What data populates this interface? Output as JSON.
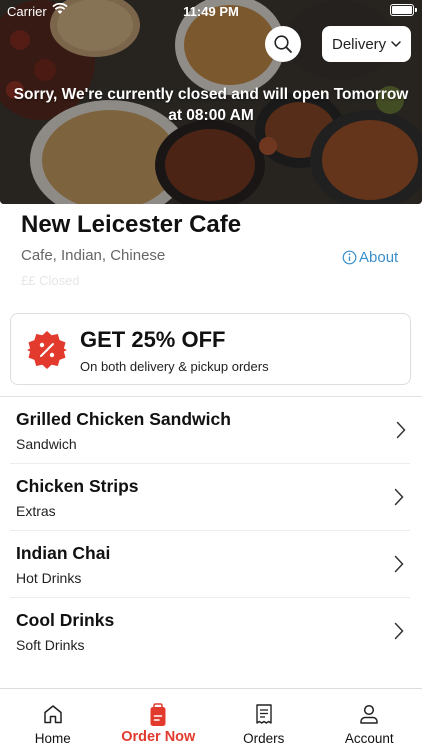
{
  "status_bar": {
    "carrier": "Carrier",
    "time": "11:49 PM"
  },
  "header": {
    "order_mode": "Delivery",
    "closed_message": "Sorry, We're currently closed and will open Tomorrow at 08:00 AM"
  },
  "restaurant": {
    "name": "New Leicester Cafe",
    "cuisines": "Cafe, Indian, Chinese",
    "about_label": "About",
    "status": "££ Closed"
  },
  "offer": {
    "title": "GET 25% OFF",
    "subtitle": "On both delivery & pickup orders",
    "icon": "percent-badge-icon"
  },
  "menu": [
    {
      "name": "Grilled Chicken Sandwich",
      "category": "Sandwich"
    },
    {
      "name": "Chicken Strips",
      "category": "Extras"
    },
    {
      "name": "Indian Chai",
      "category": "Hot Drinks"
    },
    {
      "name": "Cool Drinks",
      "category": "Soft Drinks"
    }
  ],
  "tabs": [
    {
      "label": "Home",
      "icon": "home-icon"
    },
    {
      "label": "Order Now",
      "icon": "order-bag-icon",
      "active": true
    },
    {
      "label": "Orders",
      "icon": "receipt-icon"
    },
    {
      "label": "Account",
      "icon": "user-icon"
    }
  ],
  "colors": {
    "accent": "#e23b2e",
    "link": "#3a8fc9",
    "offer_badge": "#e23b2e"
  }
}
